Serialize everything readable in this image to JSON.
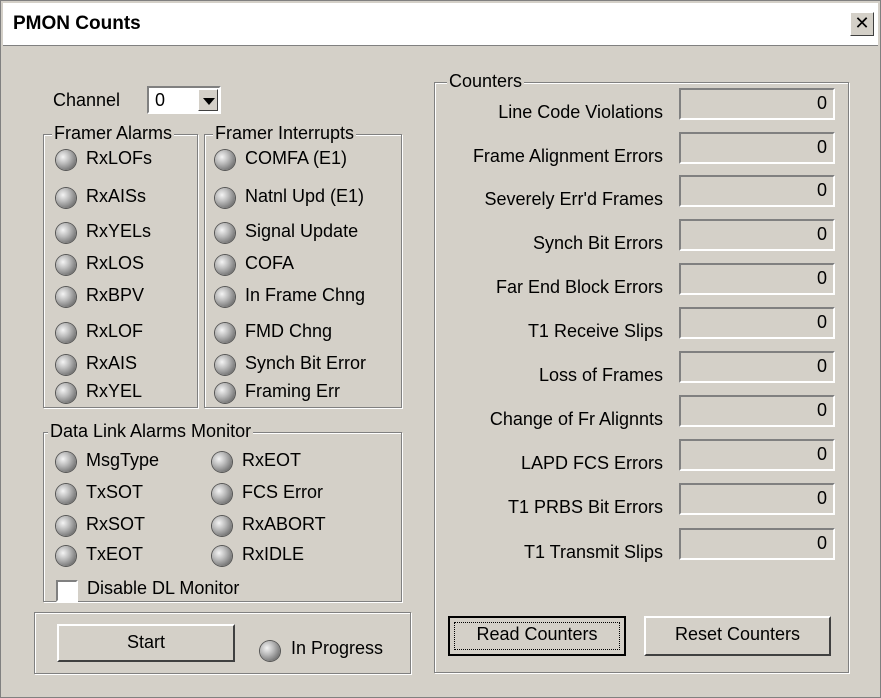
{
  "window": {
    "title": "PMON Counts",
    "close_glyph": "✕"
  },
  "channel": {
    "label": "Channel",
    "value": "0"
  },
  "framer_alarms": {
    "title": "Framer Alarms",
    "items": [
      "RxLOFs",
      "RxAISs",
      "RxYELs",
      "RxLOS",
      "RxBPV",
      "RxLOF",
      "RxAIS",
      "RxYEL"
    ]
  },
  "framer_interrupts": {
    "title": "Framer Interrupts",
    "items": [
      "COMFA (E1)",
      "Natnl Upd (E1)",
      "Signal Update",
      "COFA",
      "In Frame Chng",
      "FMD Chng",
      "Synch Bit Error",
      "Framing Err"
    ]
  },
  "dl_monitor": {
    "title": "Data Link Alarms Monitor",
    "left": [
      "MsgType",
      "TxSOT",
      "RxSOT",
      "TxEOT"
    ],
    "right": [
      "RxEOT",
      "FCS Error",
      "RxABORT",
      "RxIDLE"
    ],
    "disable_label": "Disable DL Monitor",
    "disable_checked": false
  },
  "control": {
    "start_label": "Start",
    "progress_label": "In Progress"
  },
  "counters": {
    "title": "Counters",
    "rows": [
      {
        "label": "Line Code Violations",
        "value": "0"
      },
      {
        "label": "Frame Alignment Errors",
        "value": "0"
      },
      {
        "label": "Severely Err'd Frames",
        "value": "0"
      },
      {
        "label": "Synch Bit Errors",
        "value": "0"
      },
      {
        "label": "Far End Block Errors",
        "value": "0"
      },
      {
        "label": "T1 Receive Slips",
        "value": "0"
      },
      {
        "label": "Loss of Frames",
        "value": "0"
      },
      {
        "label": "Change of Fr Alignnts",
        "value": "0"
      },
      {
        "label": "LAPD FCS Errors",
        "value": "0"
      },
      {
        "label": "T1 PRBS Bit Errors",
        "value": "0"
      },
      {
        "label": "T1 Transmit Slips",
        "value": "0"
      }
    ],
    "read_label": "Read Counters",
    "reset_label": "Reset Counters"
  }
}
